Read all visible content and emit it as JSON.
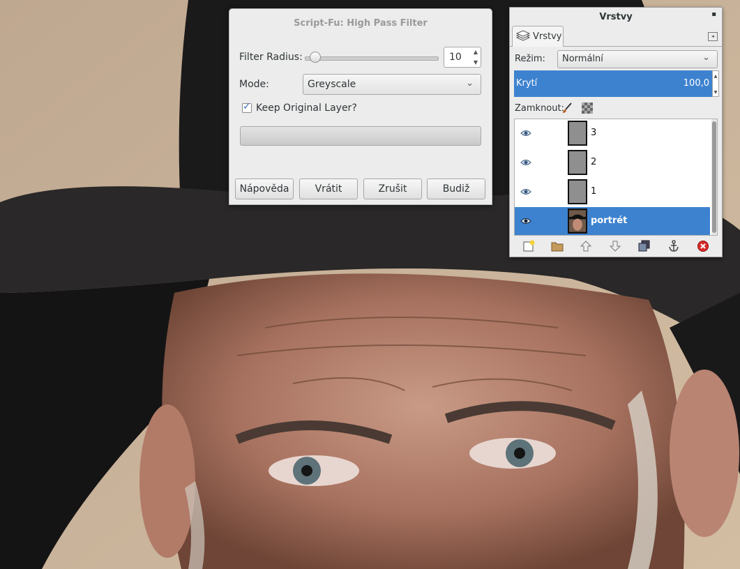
{
  "dialog": {
    "title": "Script-Fu: High Pass Filter",
    "filter_radius_label": "Filter Radius:",
    "filter_radius_value": "10",
    "filter_radius_level": 0.08,
    "mode_label": "Mode:",
    "mode_value": "Greyscale",
    "keep_label": "Keep Original Layer?",
    "keep_checked": true,
    "buttons": {
      "help": "Nápověda",
      "reset": "Vrátit",
      "cancel": "Zrušit",
      "ok": "Budiž"
    }
  },
  "layers_panel": {
    "title": "Vrstvy",
    "tab_label": "Vrstvy",
    "mode_label": "Režim:",
    "mode_value": "Normální",
    "opacity_label": "Krytí",
    "opacity_value": "100,0",
    "lock_label": "Zamknout:",
    "layers": [
      {
        "name": "3",
        "visible": true,
        "selected": false
      },
      {
        "name": "2",
        "visible": true,
        "selected": false
      },
      {
        "name": "1",
        "visible": true,
        "selected": false
      },
      {
        "name": "portrét",
        "visible": true,
        "selected": true
      }
    ],
    "toolbar_icons": [
      "new-layer-icon",
      "layer-group-icon",
      "raise-layer-icon",
      "lower-layer-icon",
      "duplicate-layer-icon",
      "anchor-layer-icon",
      "delete-layer-icon"
    ]
  },
  "colors": {
    "selection": "#3d82cf",
    "dialog_bg": "#ececec"
  }
}
